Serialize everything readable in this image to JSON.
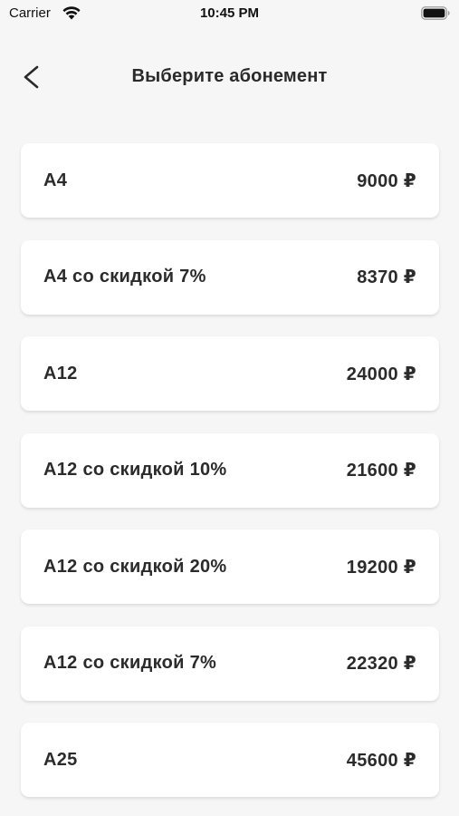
{
  "status_bar": {
    "carrier": "Carrier",
    "time": "10:45 PM"
  },
  "nav": {
    "title": "Выберите абонемент",
    "back_icon": "chevron-left-icon"
  },
  "subscriptions": [
    {
      "name": "A4",
      "price": "9000 ₽"
    },
    {
      "name": "A4 со скидкой 7%",
      "price": "8370 ₽"
    },
    {
      "name": "A12",
      "price": "24000 ₽"
    },
    {
      "name": "A12 со скидкой 10%",
      "price": "21600 ₽"
    },
    {
      "name": "A12 со скидкой 20%",
      "price": "19200 ₽"
    },
    {
      "name": "A12 со скидкой 7%",
      "price": "22320 ₽"
    },
    {
      "name": "A25",
      "price": "45600 ₽"
    }
  ],
  "colors": {
    "background": "#f6f6f6",
    "card": "#ffffff",
    "text": "#2b2b2b"
  }
}
